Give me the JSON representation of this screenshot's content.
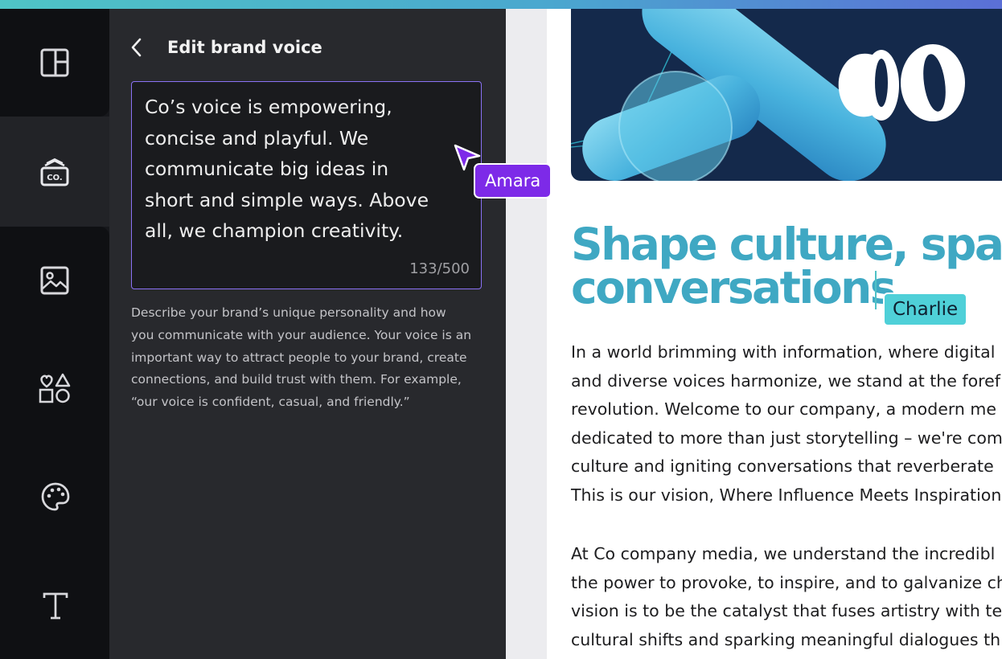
{
  "panel": {
    "title": "Edit brand voice",
    "voice_lines": [
      "Co’s voice is empowering,",
      "concise and playful. We",
      "communicate big ideas in",
      "short and simple ways. Above",
      "all, we champion creativity."
    ],
    "char_count": "133/500",
    "help_lines": [
      "Describe your brand’s unique personality and how",
      "you communicate with your audience. Your voice is an",
      "important way to attract people to your brand, create",
      "connections, and build trust with them. For example,",
      "“our voice is confident, casual, and friendly.”"
    ]
  },
  "rail": {
    "items": [
      {
        "icon": "layout-icon"
      },
      {
        "icon": "brand-kit-icon"
      },
      {
        "icon": "image-icon"
      },
      {
        "icon": "elements-icon"
      },
      {
        "icon": "palette-icon"
      },
      {
        "icon": "text-icon"
      }
    ]
  },
  "collaborators": {
    "amara": "Amara",
    "charlie": "Charlie"
  },
  "document": {
    "headline_lines": [
      "Shape culture, spark",
      "conversations"
    ],
    "paragraph1": [
      "In a world brimming with information, where digital",
      "and diverse voices harmonize, we stand at the foref",
      "revolution. Welcome to our company, a modern me",
      "dedicated to more than just storytelling – we're com",
      "culture and igniting conversations that reverberate",
      "This is our vision, Where Influence Meets Inspiration"
    ],
    "paragraph2": [
      "At Co company media, we understand the incredibl",
      "the power to provoke, to inspire, and to galvanize ch",
      "vision is to be the catalyst that fuses artistry with te",
      "cultural shifts and sparking meaningful dialogues th"
    ]
  },
  "colors": {
    "accent_purple": "#7d2ae8",
    "cursor_teal": "#4fd0d8",
    "headline_teal": "#3fa8c3",
    "hero_navy": "#14294b"
  }
}
